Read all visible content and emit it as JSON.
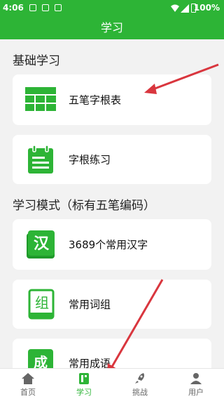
{
  "status_bar": {
    "time": "4:06",
    "battery": "100%"
  },
  "app_bar": {
    "title": "学习"
  },
  "sections": {
    "basic": "基础学习",
    "mode": "学习模式（标有五笔编码）"
  },
  "cards": {
    "root_table": "五笔字根表",
    "root_practice": "字根练习",
    "common_chars": "3689个常用汉字",
    "common_words": "常用词组",
    "common_idioms": "常用成语"
  },
  "icon_chars": {
    "han": "汉",
    "zu": "组",
    "cheng": "成"
  },
  "tabs": [
    {
      "label": "首页",
      "icon": "home-icon"
    },
    {
      "label": "学习",
      "icon": "book-icon"
    },
    {
      "label": "挑战",
      "icon": "rocket-icon"
    },
    {
      "label": "用户",
      "icon": "user-icon"
    }
  ],
  "colors": {
    "brand": "#2db436",
    "arrow": "#d9363e"
  }
}
